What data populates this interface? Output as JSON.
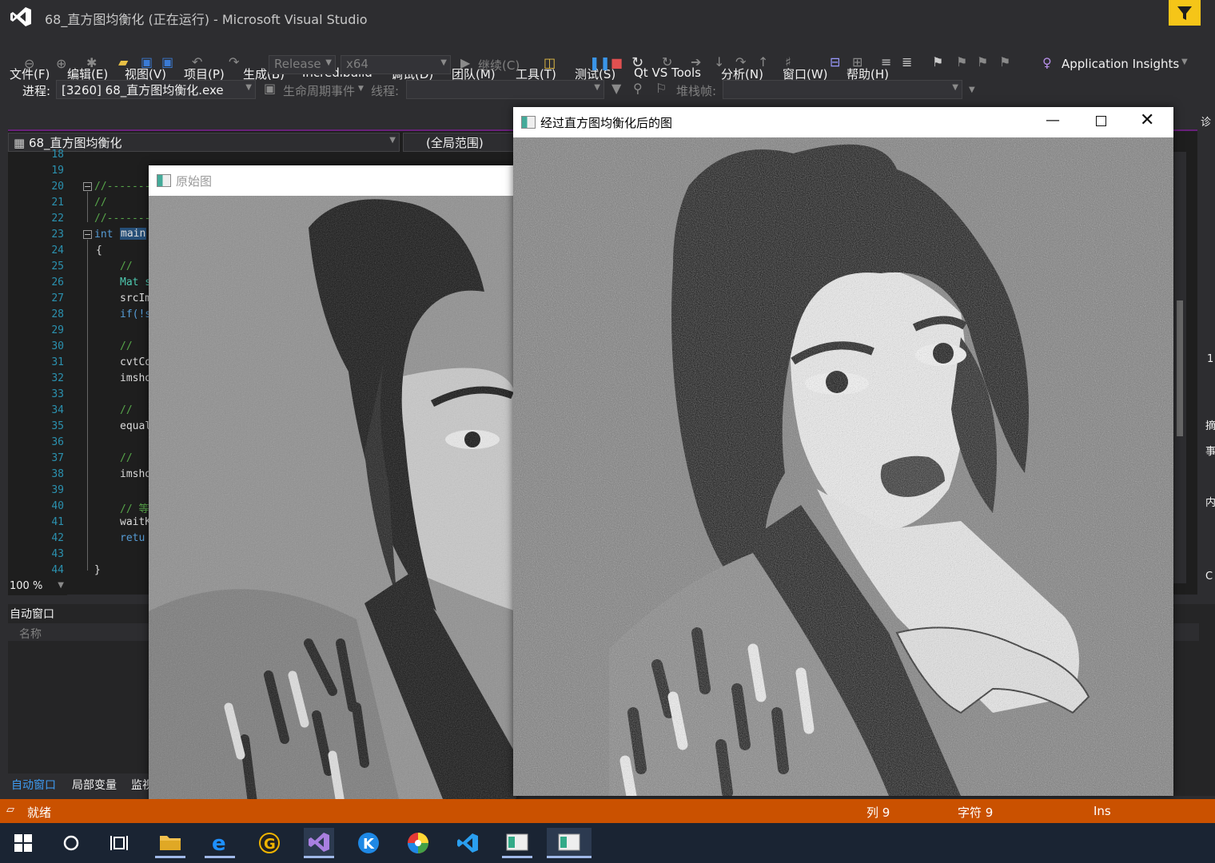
{
  "window": {
    "title": "68_直方图均衡化 (正在运行) - Microsoft Visual Studio"
  },
  "menu": [
    "文件(F)",
    "编辑(E)",
    "视图(V)",
    "项目(P)",
    "生成(B)",
    "Incredibuild",
    "调试(D)",
    "团队(M)",
    "工具(T)",
    "测试(S)",
    "Qt VS Tools",
    "分析(N)",
    "窗口(W)",
    "帮助(H)"
  ],
  "toolbar": {
    "config": "Release",
    "platform": "x64",
    "continue": "继续(C)",
    "app_insights": "Application Insights"
  },
  "debug_bar": {
    "process_label": "进程:",
    "process_value": "[3260] 68_直方图均衡化.exe",
    "lifecycle": "生命周期事件",
    "thread_label": "线程:",
    "stackframe_label": "堆栈帧:"
  },
  "editor": {
    "file_combo": "68_直方图均衡化",
    "scope_combo": "(全局范围)",
    "line_numbers": [
      "18",
      "19",
      "20",
      "21",
      "22",
      "23",
      "24",
      "25",
      "26",
      "27",
      "28",
      "29",
      "30",
      "31",
      "32",
      "33",
      "34",
      "35",
      "36",
      "37",
      "38",
      "39",
      "40",
      "41",
      "42",
      "43",
      "44"
    ],
    "lines": {
      "l20": "//-------",
      "l21": "//",
      "l22": "//-------",
      "l23_kw": "int",
      "l23_name": "main",
      "l24": "{",
      "l25": "//",
      "l26": "Mat s",
      "l27": "srcIm",
      "l28": "if(!s",
      "l30": "//",
      "l31": "cvtCo",
      "l32": "imsho",
      "l34": "//",
      "l35": "equal",
      "l37": "//",
      "l38": "imsho",
      "l40": "// 等",
      "l41": "waitK",
      "l42": "retu",
      "l44": "}"
    },
    "zoom": "100 %"
  },
  "autos_panel": {
    "title": "自动窗口",
    "column_name": "名称",
    "tabs": [
      "自动窗口",
      "局部变量",
      "监视"
    ]
  },
  "right_panel": {
    "labels": [
      "诊",
      "1",
      "摘",
      "事",
      "内",
      "C"
    ]
  },
  "statusbar": {
    "ready": "就绪",
    "col": "列 9",
    "char": "字符 9",
    "ins": "Ins"
  },
  "windows": {
    "original": {
      "title": "原始图"
    },
    "equalized": {
      "title": "经过直方图均衡化后的图"
    }
  },
  "taskbar": {
    "icons": [
      "windows-start-icon",
      "cortana-icon",
      "task-view-icon",
      "file-explorer-icon",
      "edge-icon",
      "game-icon",
      "visual-studio-icon",
      "k-app-icon",
      "color-wheel-icon",
      "vscode-icon",
      "image-window-icon",
      "image-window-icon-2"
    ]
  },
  "colors": {
    "accent_purple": "#68217a",
    "status_orange": "#ca5100",
    "notif_yellow": "#f5c518"
  }
}
